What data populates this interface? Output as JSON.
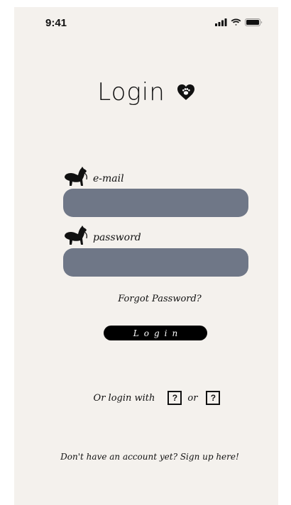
{
  "status_bar": {
    "time": "9:41",
    "icons": [
      "signal-icon",
      "wifi-icon",
      "battery-icon"
    ]
  },
  "header": {
    "title": "Login",
    "icon": "paw-heart-icon"
  },
  "form": {
    "email": {
      "label": "e-mail",
      "value": "",
      "placeholder": "",
      "icon": "dog-icon"
    },
    "password": {
      "label": "password",
      "value": "",
      "placeholder": "",
      "icon": "dog-icon"
    },
    "forgot_label": "Forgot Password?",
    "login_label": "Login"
  },
  "social": {
    "prefix": "Or login with",
    "option1": "?",
    "separator": "or",
    "option2": "?"
  },
  "footer": {
    "signup_label": "Don't have an account yet? Sign up here!"
  },
  "colors": {
    "background": "#f4f1ed",
    "input_fill": "#6f7787",
    "button_fill": "#000000",
    "text": "#111111"
  }
}
